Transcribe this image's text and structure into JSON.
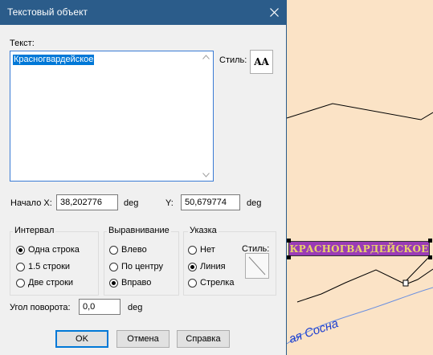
{
  "dialog": {
    "title": "Текстовый объект",
    "text_label": "Текст:",
    "text_value": "Красногвардейское",
    "style_label": "Стиль:",
    "style_button": "AA",
    "start_x_label": "Начало X:",
    "start_x_value": "38,202776",
    "x_unit": "deg",
    "y_label": "Y:",
    "y_value": "50,679774",
    "y_unit": "deg",
    "interval": {
      "title": "Интервал",
      "options": [
        "Одна строка",
        "1.5 строки",
        "Две строки"
      ],
      "selected": "Одна строка"
    },
    "alignment": {
      "title": "Выравнивание",
      "options": [
        "Влево",
        "По центру",
        "Вправо"
      ],
      "selected": "Вправо"
    },
    "pointer": {
      "title": "Указка",
      "options": [
        "Нет",
        "Линия",
        "Стрелка"
      ],
      "selected": "Линия",
      "style_label": "Стиль:"
    },
    "rotation_label": "Угол поворота:",
    "rotation_value": "0,0",
    "rotation_unit": "deg",
    "buttons": {
      "ok": "OK",
      "cancel": "Отмена",
      "help": "Справка"
    }
  },
  "map": {
    "label": "КРАСНОГВАРДЕЙСКОЕ",
    "river_label": "ая Сосна",
    "background_color": "#fbe3c6",
    "label_bg_color": "#9a3bb6",
    "label_text_color": "#e8d36a",
    "river_color": "#6a8fe0"
  }
}
